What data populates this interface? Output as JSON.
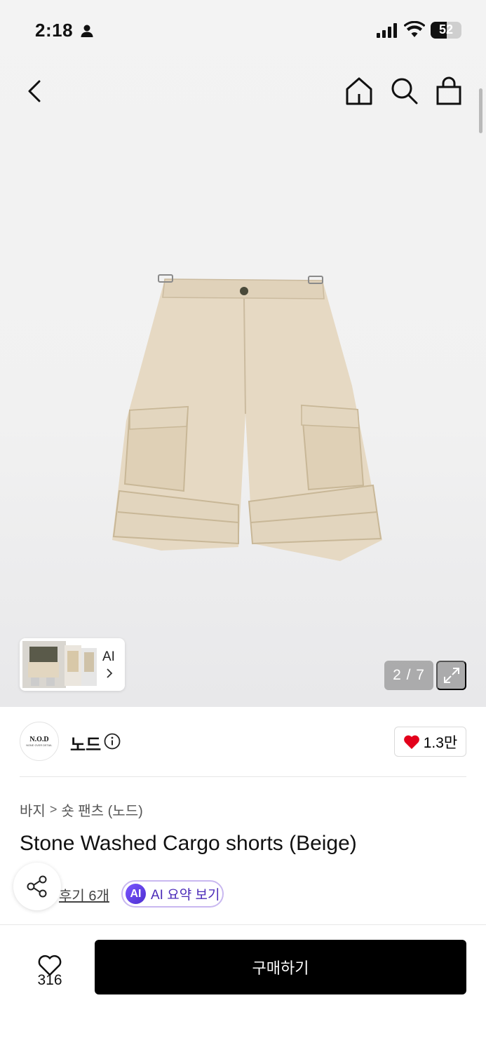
{
  "status_bar": {
    "time": "2:18",
    "battery": "52",
    "battery_level": 0.52
  },
  "gallery": {
    "thumbnail_label": "AI",
    "counter": "2 / 7"
  },
  "brand": {
    "logo_line1": "N.O.D",
    "logo_line2": "NONE OVER DETAIL",
    "name": "노드",
    "likes": "1.3만"
  },
  "product": {
    "breadcrumb": [
      "바지",
      "숏 팬츠 (노드)"
    ],
    "title": "Stone Washed Cargo shorts (Beige)",
    "review_link": "후기 6개",
    "ai_summary_badge": "AI",
    "ai_summary_label": "AI 요약 보기"
  },
  "bottom_bar": {
    "wish_count": "316",
    "buy_label": "구매하기"
  },
  "colors": {
    "accent_purple": "#4b2bb8",
    "heart_red": "#e3001b",
    "buy_button": "#000000"
  }
}
